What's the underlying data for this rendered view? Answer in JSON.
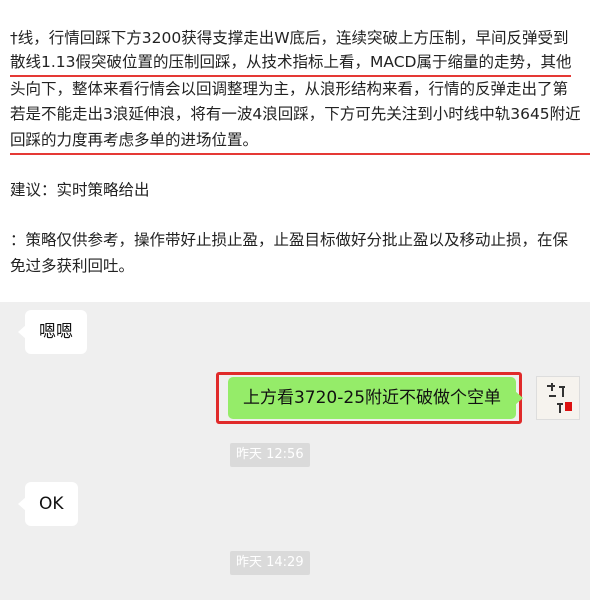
{
  "article": {
    "lines": [
      "†线，行情回踩下方3200获得支撑走出W底后，连续突破上方压制，早间反弹受到",
      "散线1.13假突破位置的压制回踩，从技术指标上看，MACD属于缩量的走势，其他",
      "头向下，整体来看行情会以回调整理为主，从浪形结构来看，行情的反弹走出了第",
      "若是不能走出3浪延伸浪，将有一波4浪回踩，下方可先关注到小时线中轨3645附近",
      "回踩的力度再考虑多单的进场位置。",
      "建议：实时策略给出",
      "：策略仅供参考，操作带好止损止盈，止盈目标做好分批止盈以及移动止损，在保",
      "免过多获利回吐。"
    ]
  },
  "chat": {
    "messages": [
      {
        "side": "left",
        "text": "嗯嗯"
      },
      {
        "side": "right",
        "text": "上方看3720-25附近不破做个空单"
      },
      {
        "side": "time",
        "text": "昨天 12:56"
      },
      {
        "side": "left",
        "text": "OK"
      },
      {
        "side": "time",
        "text": "昨天 14:29"
      }
    ],
    "colors": {
      "chat_bg": "#efefef",
      "bubble_self": "#95ec69",
      "bubble_other": "#ffffff",
      "highlight": "#e02a2a"
    },
    "avatar_icon": "calligraphy-avatar"
  }
}
